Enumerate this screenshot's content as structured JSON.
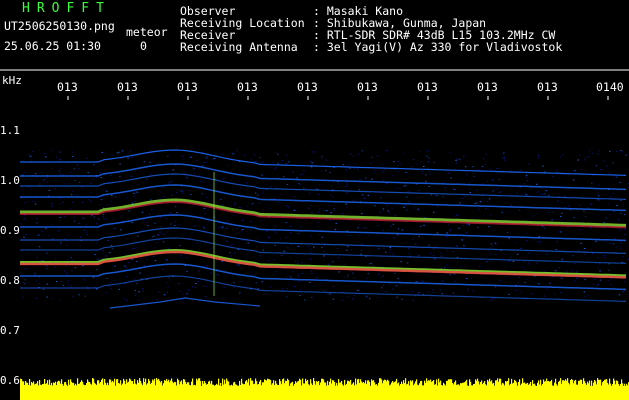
{
  "header": {
    "brand": "HROFFT",
    "filename": "UT2506250130.png",
    "meteor_label": "meteor",
    "date_time": "25.06.25 01:30",
    "count": "0",
    "fields": [
      {
        "label": "Observer",
        "value": ": Masaki Kano"
      },
      {
        "label": "Receiving Location",
        "value": ": Shibukawa, Gunma, Japan"
      },
      {
        "label": "Receiver",
        "value": ": RTL-SDR SDR# 43dB L15 103.2MHz CW"
      },
      {
        "label": "Receiving Antenna",
        "value": ": 3el Yagi(V) Az 330 for Vladivostok"
      }
    ]
  },
  "axis": {
    "unit": "kHz",
    "y_ticks": [
      "1.1",
      "1.0",
      "0.9",
      "0.8",
      "0.7",
      "0.6"
    ],
    "time_ticks": [
      "013",
      "013",
      "013",
      "013",
      "013",
      "013",
      "013",
      "013",
      "013",
      "0140"
    ]
  },
  "colors": {
    "background": "#000000",
    "brand_green": "#39ff3a",
    "signal_low": "#0a1aa0",
    "signal_mid": "#1e6cff",
    "signal_high": "#ff2a4a",
    "signal_warm": "#9cff3a",
    "level_bar": "#ffff00"
  }
}
